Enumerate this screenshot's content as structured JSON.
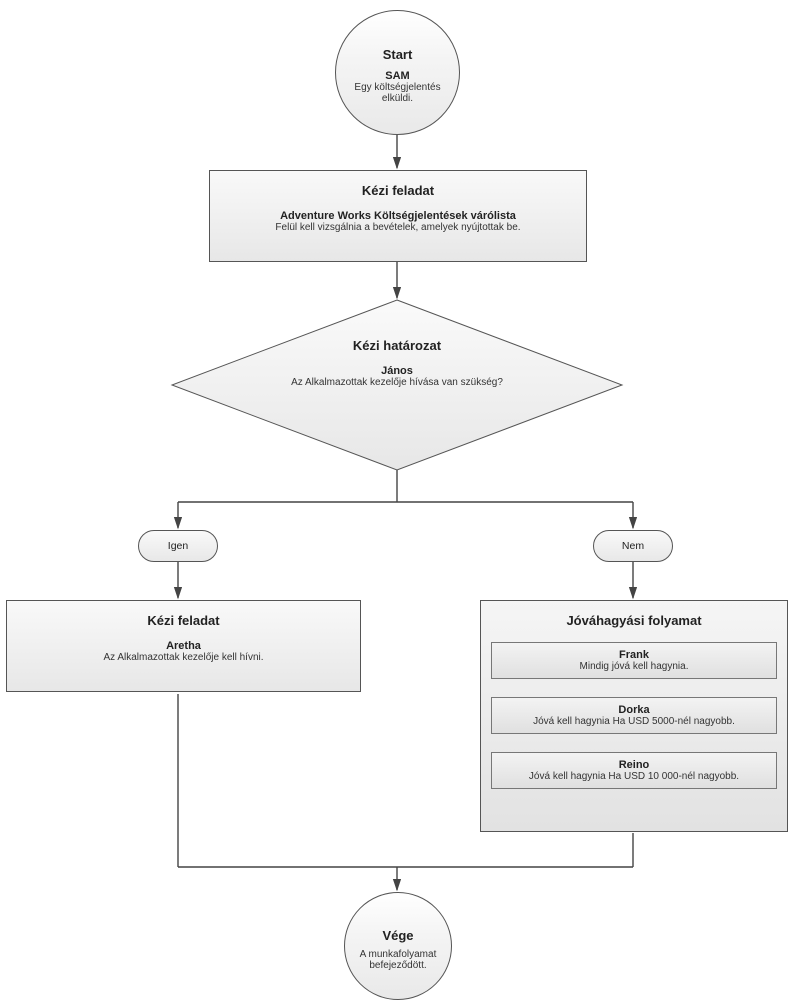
{
  "start": {
    "title": "Start",
    "actor": "SAM",
    "desc": "Egy költségjelentés elküldi."
  },
  "task1": {
    "title": "Kézi feladat",
    "actor": "Adventure Works Költségjelentések várólista",
    "desc": "Felül kell vizsgálnia a bevételek, amelyek nyújtottak be."
  },
  "decision": {
    "title": "Kézi határozat",
    "actor": "János",
    "desc": "Az Alkalmazottak kezelője hívása van szükség?"
  },
  "branches": {
    "yes": "Igen",
    "no": "Nem"
  },
  "task2": {
    "title": "Kézi feladat",
    "actor": "Aretha",
    "desc": "Az Alkalmazottak kezelője kell hívni."
  },
  "approval": {
    "title": "Jóváhagyási folyamat",
    "steps": [
      {
        "actor": "Frank",
        "desc": "Mindig jóvá kell hagynia."
      },
      {
        "actor": "Dorka",
        "desc": "Jóvá kell hagynia Ha USD 5000-nél nagyobb."
      },
      {
        "actor": "Reino",
        "desc": "Jóvá kell hagynia Ha USD 10 000-nél nagyobb."
      }
    ]
  },
  "end": {
    "title": "Vége",
    "desc": "A munkafolyamat befejeződött."
  }
}
